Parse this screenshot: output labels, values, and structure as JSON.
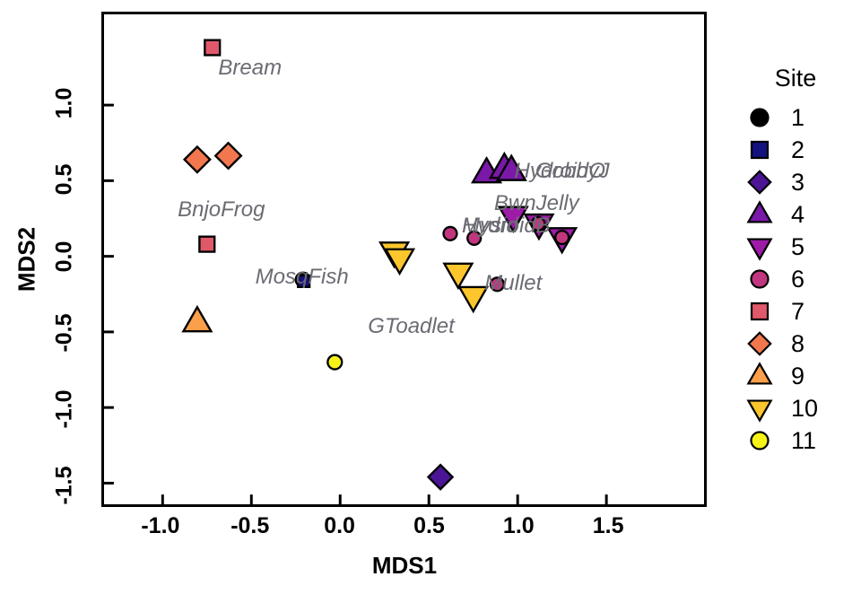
{
  "chart_data": {
    "type": "scatter",
    "title": "",
    "xlabel": "MDS1",
    "ylabel": "MDS2",
    "xlim": [
      -1.33,
      2.05
    ],
    "ylim": [
      -1.64,
      1.6
    ],
    "xticks": [
      "-1.0",
      "-0.5",
      "0.0",
      "0.5",
      "1.0",
      "1.5"
    ],
    "xtick_values": [
      -1.0,
      -0.5,
      0.0,
      0.5,
      1.0,
      1.5
    ],
    "yticks": [
      "-1.5",
      "-1.0",
      "-0.5",
      "0.0",
      "0.5",
      "1.0"
    ],
    "ytick_values": [
      -1.5,
      -1.0,
      -0.5,
      0.0,
      0.5,
      1.0
    ],
    "grid": false,
    "legend_position": "right",
    "legend_title": "Site",
    "series": [
      {
        "name": "1",
        "shape": "circle",
        "color": "#000000",
        "size": 16,
        "points": [
          [
            -0.21,
            -0.155
          ]
        ]
      },
      {
        "name": "2",
        "shape": "square",
        "color": "#14127e",
        "size": 13,
        "points": [
          [
            -0.205,
            -0.165
          ]
        ]
      },
      {
        "name": "3",
        "shape": "diamond",
        "color": "#4b1596",
        "size": 19,
        "points": [
          [
            0.565,
            -1.46
          ]
        ]
      },
      {
        "name": "4",
        "shape": "triangle-up",
        "color": "#7a18a8",
        "size": 21,
        "points": [
          [
            0.825,
            0.55
          ],
          [
            0.925,
            0.58
          ],
          [
            0.965,
            0.565
          ]
        ]
      },
      {
        "name": "5",
        "shape": "triangle-down",
        "color": "#9e1ba8",
        "size": 21,
        "points": [
          [
            0.975,
            0.265
          ],
          [
            1.12,
            0.215
          ],
          [
            1.25,
            0.125
          ]
        ]
      },
      {
        "name": "6",
        "shape": "circle",
        "color": "#c2367f",
        "size": 15,
        "points": [
          [
            0.62,
            0.15
          ],
          [
            0.755,
            0.12
          ],
          [
            0.885,
            -0.185
          ],
          [
            1.115,
            0.215
          ],
          [
            1.25,
            0.125
          ]
        ]
      },
      {
        "name": "7",
        "shape": "square",
        "color": "#e0596b",
        "size": 17,
        "points": [
          [
            -0.72,
            1.38
          ],
          [
            -0.75,
            0.08
          ]
        ]
      },
      {
        "name": "8",
        "shape": "diamond",
        "color": "#f2774f",
        "size": 20,
        "points": [
          [
            -0.805,
            0.64
          ],
          [
            -0.63,
            0.665
          ]
        ]
      },
      {
        "name": "9",
        "shape": "triangle-up",
        "color": "#fba04a",
        "size": 21,
        "points": [
          [
            -0.805,
            -0.435
          ]
        ]
      },
      {
        "name": "10",
        "shape": "triangle-down",
        "color": "#fcc62c",
        "size": 21,
        "points": [
          [
            0.305,
            0.03
          ],
          [
            0.335,
            -0.015
          ],
          [
            0.665,
            -0.11
          ],
          [
            0.75,
            -0.265
          ]
        ]
      },
      {
        "name": "11",
        "shape": "circle",
        "color": "#f7f318",
        "size": 16,
        "points": [
          [
            -0.03,
            -0.7
          ]
        ]
      }
    ],
    "annotations": [
      {
        "text": "Bream",
        "x": -0.5,
        "y": 1.23,
        "anchor": "middle"
      },
      {
        "text": "BnjoFrog",
        "x": -0.66,
        "y": 0.3,
        "anchor": "middle"
      },
      {
        "text": "MosqFish",
        "x": -0.21,
        "y": -0.14,
        "anchor": "middle"
      },
      {
        "text": "GToadlet",
        "x": 0.4,
        "y": -0.46,
        "anchor": "middle"
      },
      {
        "text": "Mullet",
        "x": 0.97,
        "y": -0.18,
        "anchor": "middle"
      },
      {
        "text": "BwnJelly",
        "x": 1.1,
        "y": 0.345,
        "anchor": "middle"
      },
      {
        "text": "HydroidO",
        "x": 1.23,
        "y": 0.555,
        "anchor": "middle"
      },
      {
        "text": "GobbyJ",
        "x": 1.3,
        "y": 0.555,
        "anchor": "middle"
      },
      {
        "text": "Mysid",
        "x": 0.84,
        "y": 0.195,
        "anchor": "middle"
      },
      {
        "text": "HydroidB",
        "x": 0.93,
        "y": 0.195,
        "anchor": "middle"
      }
    ]
  },
  "axes": {
    "x_title": "MDS1",
    "y_title": "MDS2"
  },
  "legend": {
    "title": "Site",
    "items": [
      {
        "label": "1",
        "shape": "circle",
        "color": "#000000"
      },
      {
        "label": "2",
        "shape": "square",
        "color": "#14127e"
      },
      {
        "label": "3",
        "shape": "diamond",
        "color": "#4b1596"
      },
      {
        "label": "4",
        "shape": "triangle-up",
        "color": "#7a18a8"
      },
      {
        "label": "5",
        "shape": "triangle-down",
        "color": "#9e1ba8"
      },
      {
        "label": "6",
        "shape": "circle",
        "color": "#c2367f"
      },
      {
        "label": "7",
        "shape": "square",
        "color": "#e0596b"
      },
      {
        "label": "8",
        "shape": "diamond",
        "color": "#f2774f"
      },
      {
        "label": "9",
        "shape": "triangle-up",
        "color": "#fba04a"
      },
      {
        "label": "10",
        "shape": "triangle-down",
        "color": "#fcc62c"
      },
      {
        "label": "11",
        "shape": "circle",
        "color": "#f7f318"
      }
    ]
  }
}
